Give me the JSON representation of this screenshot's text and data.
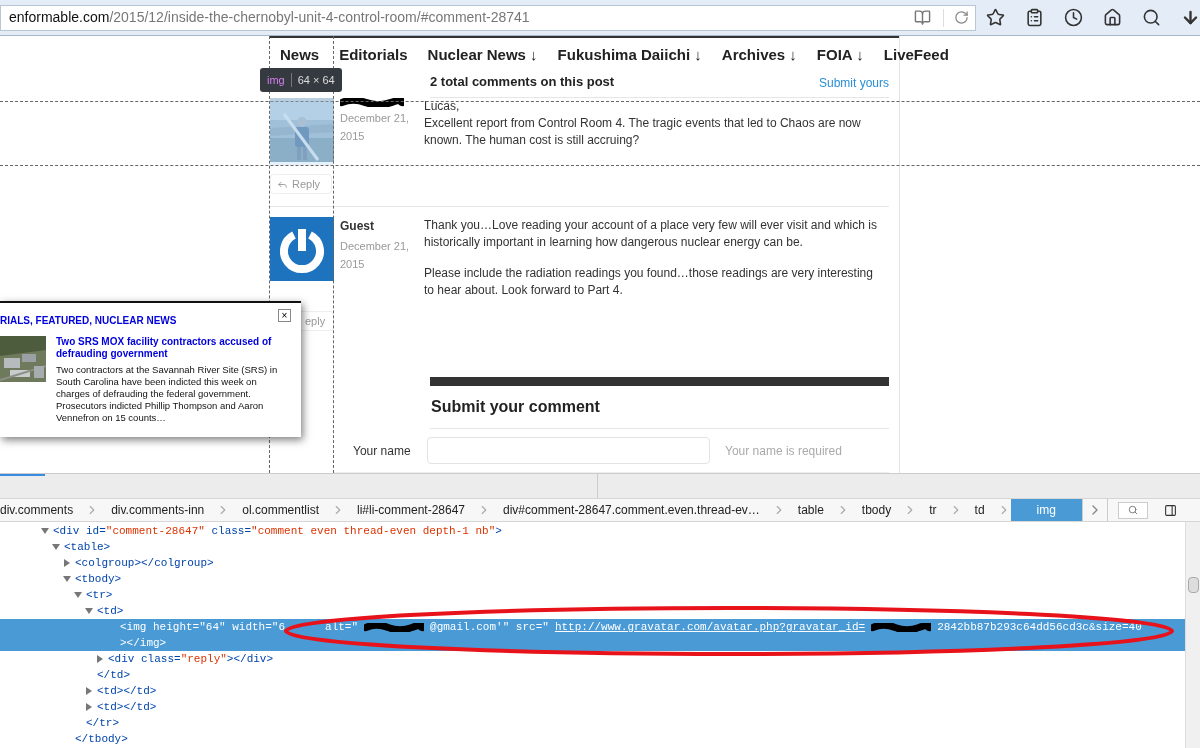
{
  "browser": {
    "url_domain": "enformable.com",
    "url_path": "/2015/12/inside-the-chernobyl-unit-4-control-room/#comment-28741"
  },
  "nav": [
    {
      "label": "News"
    },
    {
      "label": "Editorials"
    },
    {
      "label": "Nuclear News ↓"
    },
    {
      "label": "Fukushima Daiichi ↓"
    },
    {
      "label": "Archives ↓"
    },
    {
      "label": "FOIA ↓"
    },
    {
      "label": "LiveFeed"
    }
  ],
  "comments_header": {
    "title": "2 total comments on this post",
    "link": "Submit yours"
  },
  "inspector_tooltip": {
    "tag": "img",
    "size": "64 × 64"
  },
  "comments": [
    {
      "kind": "picture",
      "name_redacted": true,
      "date": "December 21, 2015",
      "paragraphs": [
        "Lucas,\nExcellent report from Control Room 4. The tragic events that led to Chaos are now known. The human cost is still accruing?"
      ],
      "reply": "Reply"
    },
    {
      "kind": "logo",
      "name_redacted": false,
      "name": "Guest",
      "date": "December 21, 2015",
      "paragraphs": [
        "Thank you…Love reading your account of a place very few will ever visit and which is historically important in learning how dangerous nuclear energy can be.",
        "Please include the radiation readings you found…those readings are very interesting to hear about. Look forward to Part 4."
      ],
      "reply": "eply"
    }
  ],
  "popup": {
    "categories": "RIALS, FEATURED, NUCLEAR NEWS",
    "close": "×",
    "title": "Two SRS MOX facility contractors accused of defrauding government",
    "excerpt": "Two contractors at the Savannah River Site (SRS) in South Carolina have been indicted this week on charges of defrauding the federal government. Prosecutors indicted Phillip Thompson and Aaron Vennefron on 15 counts…"
  },
  "comment_form": {
    "title": "Submit your comment",
    "field_label": "Your name",
    "field_hint": "Your name is required"
  },
  "devtools": {
    "breadcrumbs": [
      {
        "label": "div.comments",
        "selected": false
      },
      {
        "label": "div.comments-inn",
        "selected": false
      },
      {
        "label": "ol.commentlist",
        "selected": false
      },
      {
        "label": "li#li-comment-28647",
        "selected": false
      },
      {
        "label": "div#comment-28647.comment.even.thread-ev…",
        "selected": false
      },
      {
        "label": "table",
        "selected": false
      },
      {
        "label": "tbody",
        "selected": false
      },
      {
        "label": "tr",
        "selected": false
      },
      {
        "label": "td",
        "selected": false
      },
      {
        "label": "img",
        "selected": true
      }
    ],
    "tree": [
      {
        "text": "<div id=\"comment-28647\" class=\"comment even thread-even depth-1 nb\">",
        "expanded": true,
        "selected": false,
        "children": [
          {
            "text": "<table>",
            "expanded": true,
            "selected": false,
            "children": [
              {
                "text": "<colgroup></colgroup>",
                "expanded": false,
                "selected": false
              },
              {
                "text": "<tbody>",
                "expanded": true,
                "selected": false,
                "closing": "</tbody>",
                "children": [
                  {
                    "text": "<tr>",
                    "expanded": true,
                    "selected": false,
                    "closing": "</tr>",
                    "children": [
                      {
                        "text": "<td>",
                        "expanded": true,
                        "selected": false,
                        "closing": "</td>",
                        "children": [
                          {
                            "selected": true,
                            "parts": [
                              {
                                "kind": "code",
                                "text": "<img height=\"64\" width=\"6"
                              },
                              {
                                "kind": "code",
                                "text": "alt=\""
                              },
                              {
                                "kind": "redacted"
                              },
                              {
                                "kind": "code",
                                "text": "@gmail.com'\" src=\""
                              },
                              {
                                "kind": "link",
                                "text": "http://www.gravatar.com/avatar.php?gravatar_id="
                              },
                              {
                                "kind": "redacted"
                              },
                              {
                                "kind": "code",
                                "text": "2842bb87b293c64dd56cd3c&size=40"
                              }
                            ],
                            "wrap": "></img>"
                          },
                          {
                            "text": "<div class=\"reply\"></div>",
                            "expanded": false,
                            "selected": false
                          }
                        ]
                      },
                      {
                        "text": "<td></td>",
                        "expanded": false,
                        "selected": false
                      },
                      {
                        "text": "<td></td>",
                        "expanded": false,
                        "selected": false
                      }
                    ]
                  }
                ]
              }
            ]
          }
        ]
      }
    ]
  }
}
